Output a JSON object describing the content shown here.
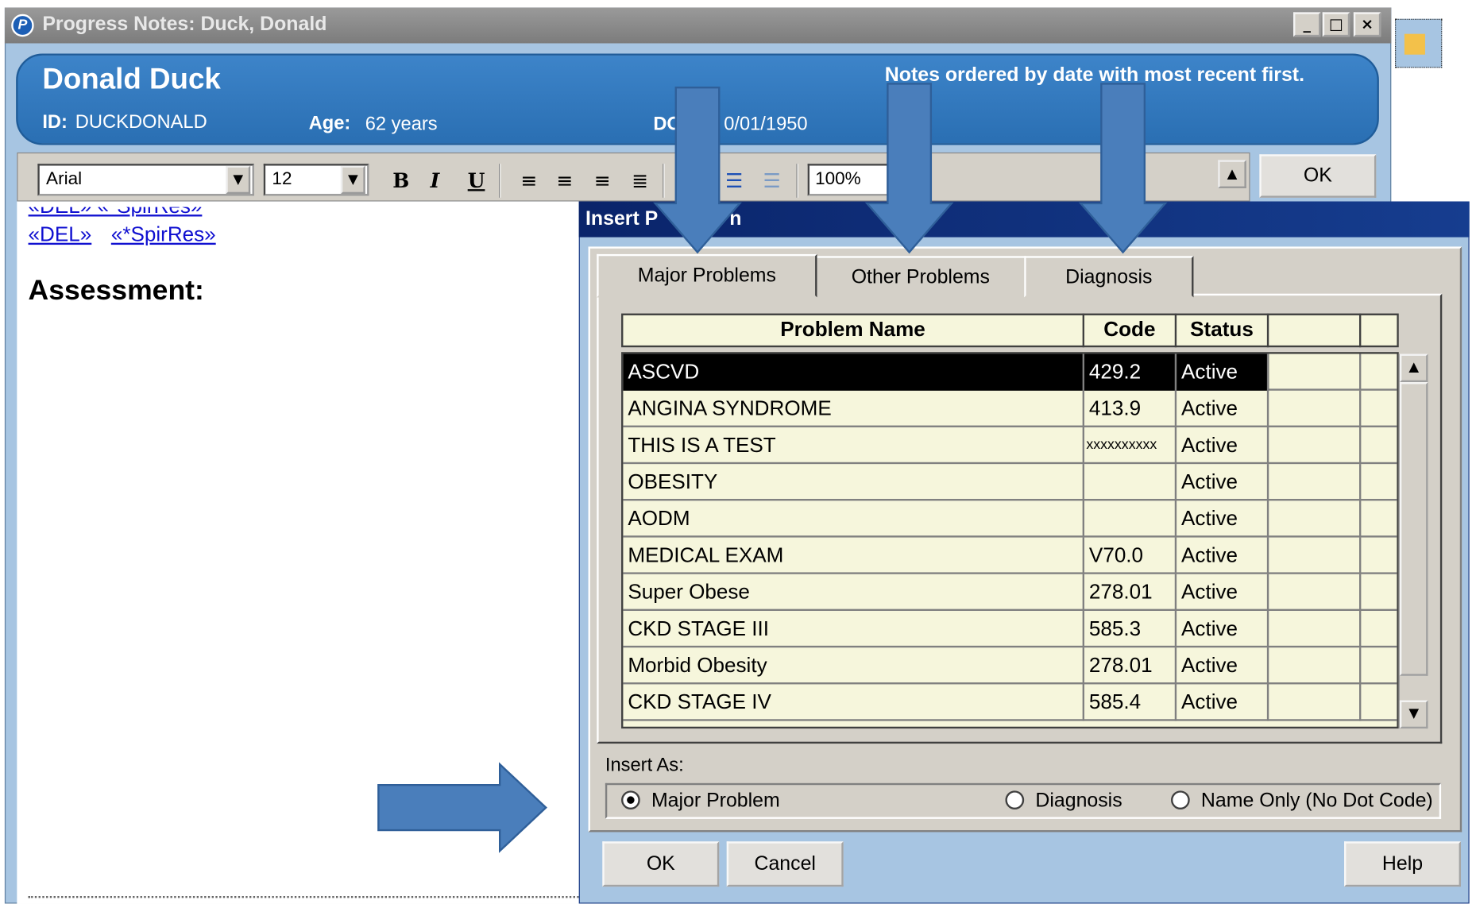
{
  "window": {
    "title": "Progress Notes: Duck, Donald",
    "controls": [
      "_",
      "□",
      "×"
    ]
  },
  "patient": {
    "name": "Donald Duck",
    "id_label": "ID:",
    "id_value": "DUCKDONALD",
    "age_label": "Age:",
    "age_value": "62 years",
    "dob_label": "DO",
    "dob_value": "0/01/1950",
    "note": "Notes ordered by date with most recent first."
  },
  "toolbar": {
    "font": "Arial",
    "size": "12",
    "bold": "B",
    "italic": "I",
    "underline": "U",
    "zoom": "100%",
    "ok_label": "OK"
  },
  "editor": {
    "links": [
      "«DEL»",
      "«*SpirRes»"
    ],
    "heading": "Assessment:"
  },
  "dialog": {
    "title": "Insert P",
    "title_tail": "n",
    "tabs": [
      {
        "label": "Major Problems",
        "active": true
      },
      {
        "label": "Other Problems",
        "active": false
      },
      {
        "label": "Diagnosis",
        "active": false
      }
    ],
    "columns": [
      "Problem Name",
      "Code",
      "Status"
    ],
    "rows": [
      {
        "name": "ASCVD",
        "code": "429.2",
        "status": "Active"
      },
      {
        "name": "ANGINA SYNDROME",
        "code": "413.9",
        "status": "Active"
      },
      {
        "name": "THIS IS A TEST",
        "code": "xxxxxxxxxx",
        "status": "Active"
      },
      {
        "name": "OBESITY",
        "code": "",
        "status": "Active"
      },
      {
        "name": "AODM",
        "code": "",
        "status": "Active"
      },
      {
        "name": "MEDICAL EXAM",
        "code": "V70.0",
        "status": "Active"
      },
      {
        "name": "Super Obese",
        "code": "278.01",
        "status": "Active"
      },
      {
        "name": "CKD STAGE III",
        "code": "585.3",
        "status": "Active"
      },
      {
        "name": "Morbid Obesity",
        "code": "278.01",
        "status": "Active"
      },
      {
        "name": "CKD STAGE IV",
        "code": "585.4",
        "status": "Active"
      }
    ],
    "insert_as_label": "Insert As:",
    "insert_options": [
      {
        "label": "Major Problem",
        "selected": true
      },
      {
        "label": "Diagnosis",
        "selected": false
      },
      {
        "label": "Name Only (No Dot Code)",
        "selected": false
      }
    ],
    "buttons": {
      "ok": "OK",
      "cancel": "Cancel",
      "help": "Help"
    }
  },
  "colors": {
    "window_bg": "#a7c5e2",
    "header_blue": "#2a6fb3",
    "dialog_title": "#0a246a",
    "grid_bg": "#f6f6dc",
    "arrow_fill": "#4a7ebb",
    "arrow_stroke": "#2f5f99"
  },
  "icons": {
    "app": "app-logo-icon",
    "bullets": "bullet-list-icon",
    "indent": "indent-icon"
  }
}
